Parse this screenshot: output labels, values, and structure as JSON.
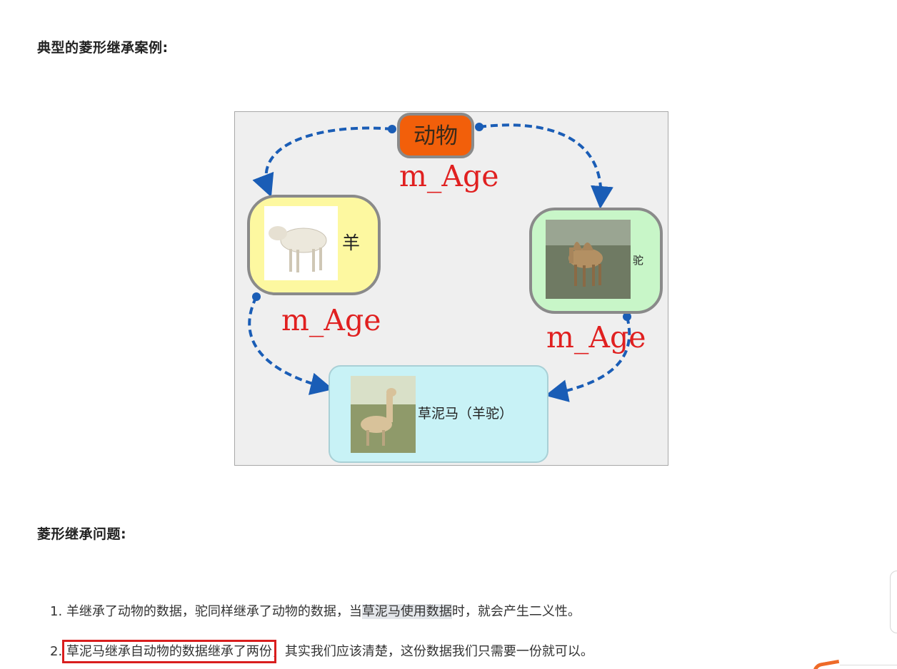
{
  "headings": {
    "example": "典型的菱形继承案例:",
    "problem": "菱形继承问题:"
  },
  "diagram": {
    "animal_label": "动物",
    "sheep_label": "羊",
    "camel_label": "驼",
    "alpaca_label": "草泥马（羊驼）",
    "member_top": "m_Age",
    "member_left": "m_Age",
    "member_right": "m_Age"
  },
  "list": {
    "item1": {
      "num": "1.",
      "text_a": "羊继承了动物的数据，驼同样继承了动物的数据，当",
      "text_highlight": "草泥马使用数据",
      "text_b": "时，就会产生二义性。"
    },
    "item2": {
      "num": "2.",
      "text_boxed": "草泥马继承自动物的数据继承了两份",
      "text_rest": "，其实我们应该清楚，这份数据我们只需要一份就可以。"
    }
  },
  "colors": {
    "animal_fill": "#f25f0a",
    "sheep_fill": "#fdf8a0",
    "camel_fill": "#c8f6c8",
    "alpaca_fill": "#c8f2f6",
    "arrow": "#1a5db6",
    "member_text": "#e02020",
    "highlight_box": "#d91e1e"
  }
}
